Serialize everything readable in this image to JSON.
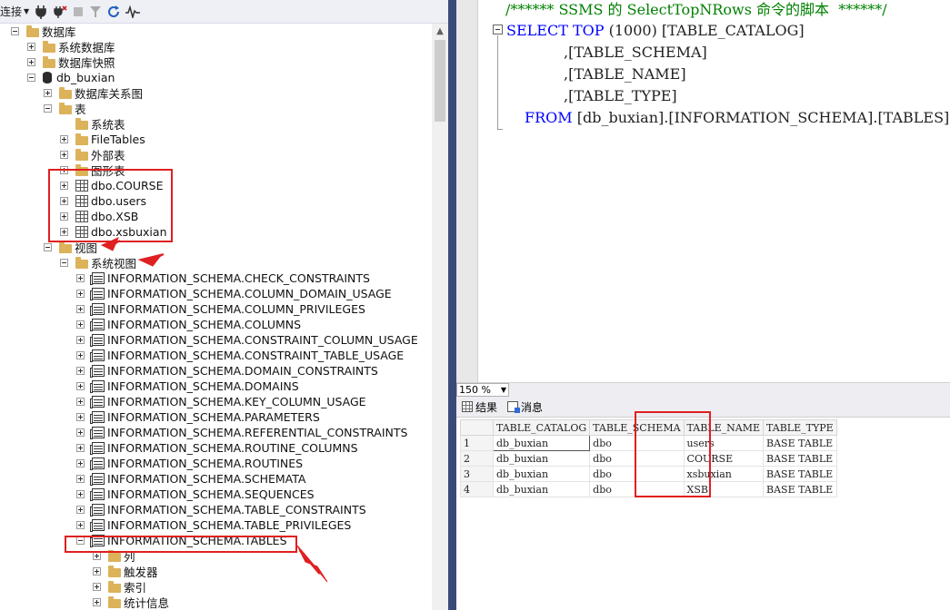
{
  "toolbar": {
    "connect_label": "连接",
    "icons": [
      "connect-dropdown-icon",
      "plug-icon",
      "disconnect-icon",
      "stop-icon",
      "filter-icon",
      "refresh-icon",
      "activity-monitor-icon"
    ]
  },
  "tree": {
    "databases": "数据库",
    "system_databases": "系统数据库",
    "db_snapshots": "数据库快照",
    "db_name": "db_buxian",
    "db_diagrams": "数据库关系图",
    "tables": "表",
    "system_tables": "系统表",
    "file_tables": "FileTables",
    "external_tables": "外部表",
    "graph_tables": "图形表",
    "user_tables": [
      "dbo.COURSE",
      "dbo.users",
      "dbo.XSB",
      "dbo.xsbuxian"
    ],
    "views": "视图",
    "system_views": "系统视图",
    "schema_views": [
      "INFORMATION_SCHEMA.CHECK_CONSTRAINTS",
      "INFORMATION_SCHEMA.COLUMN_DOMAIN_USAGE",
      "INFORMATION_SCHEMA.COLUMN_PRIVILEGES",
      "INFORMATION_SCHEMA.COLUMNS",
      "INFORMATION_SCHEMA.CONSTRAINT_COLUMN_USAGE",
      "INFORMATION_SCHEMA.CONSTRAINT_TABLE_USAGE",
      "INFORMATION_SCHEMA.DOMAIN_CONSTRAINTS",
      "INFORMATION_SCHEMA.DOMAINS",
      "INFORMATION_SCHEMA.KEY_COLUMN_USAGE",
      "INFORMATION_SCHEMA.PARAMETERS",
      "INFORMATION_SCHEMA.REFERENTIAL_CONSTRAINTS",
      "INFORMATION_SCHEMA.ROUTINE_COLUMNS",
      "INFORMATION_SCHEMA.ROUTINES",
      "INFORMATION_SCHEMA.SCHEMATA",
      "INFORMATION_SCHEMA.SEQUENCES",
      "INFORMATION_SCHEMA.TABLE_CONSTRAINTS",
      "INFORMATION_SCHEMA.TABLE_PRIVILEGES",
      "INFORMATION_SCHEMA.TABLES"
    ],
    "tables_view_children": [
      "列",
      "触发器",
      "索引",
      "统计信息"
    ]
  },
  "editor": {
    "comment": "/****** SSMS 的 SelectTopNRows 命令的脚本  ******/",
    "select_kw": "SELECT",
    "top_kw": "TOP",
    "top_value": "(1000)",
    "col1": "[TABLE_CATALOG]",
    "col2": ",[TABLE_SCHEMA]",
    "col3": ",[TABLE_NAME]",
    "col4": ",[TABLE_TYPE]",
    "from_kw": "FROM",
    "from_target": "[db_buxian].[INFORMATION_SCHEMA].[TABLES]"
  },
  "zoom": "150 %",
  "results_tabs": {
    "results": "结果",
    "messages": "消息"
  },
  "grid": {
    "headers": [
      "TABLE_CATALOG",
      "TABLE_SCHEMA",
      "TABLE_NAME",
      "TABLE_TYPE"
    ],
    "rows": [
      [
        "1",
        "db_buxian",
        "dbo",
        "users",
        "BASE TABLE"
      ],
      [
        "2",
        "db_buxian",
        "dbo",
        "COURSE",
        "BASE TABLE"
      ],
      [
        "3",
        "db_buxian",
        "dbo",
        "xsbuxian",
        "BASE TABLE"
      ],
      [
        "4",
        "db_buxian",
        "dbo",
        "XSB",
        "BASE TABLE"
      ]
    ]
  },
  "colors": {
    "annotation": "#e02020",
    "keyword": "#0000ff",
    "comment": "#008000",
    "splitter": "#3a4a78"
  }
}
